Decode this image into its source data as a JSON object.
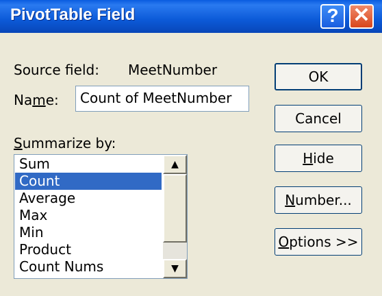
{
  "window": {
    "title": "PivotTable Field",
    "help_button": "?",
    "close_button": "✕"
  },
  "source_field": {
    "label": "Source field:",
    "value": "MeetNumber"
  },
  "name_field": {
    "label": "Name:",
    "value": "Count of MeetNumber"
  },
  "summarize": {
    "label": "Summarize by:",
    "selected": "Count",
    "items": [
      "Sum",
      "Count",
      "Average",
      "Max",
      "Min",
      "Product",
      "Count Nums"
    ]
  },
  "buttons": {
    "ok": "OK",
    "cancel": "Cancel",
    "hide": "Hide",
    "number": "Number...",
    "options": "Options >>"
  },
  "colors": {
    "title_bar": "#0a5ce0",
    "selection": "#316ac5",
    "dialog_background": "#ece9d8"
  }
}
